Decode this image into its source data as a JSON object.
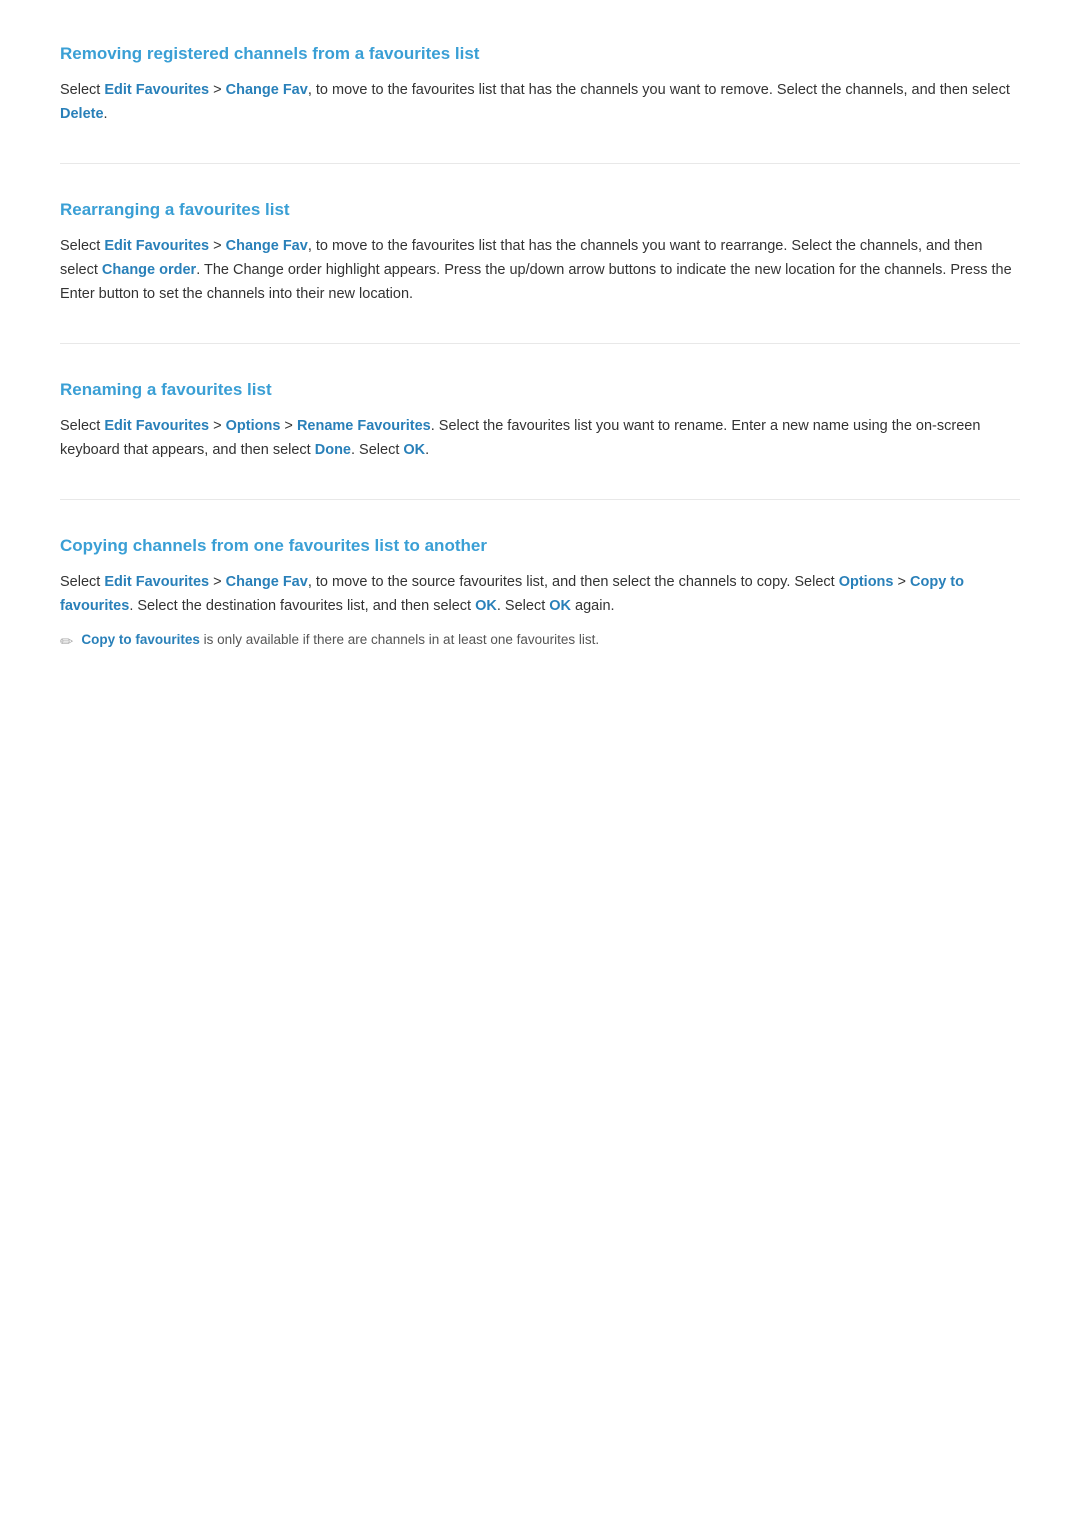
{
  "sections": [
    {
      "id": "removing",
      "title": "Removing registered channels from a favourites list",
      "body_parts": [
        {
          "type": "text",
          "text": "Select "
        },
        {
          "type": "highlight",
          "text": "Edit Favourites"
        },
        {
          "type": "text",
          "text": " > "
        },
        {
          "type": "highlight",
          "text": "Change Fav"
        },
        {
          "type": "text",
          "text": ", to move to the favourites list that has the channels you want to remove. Select the channels, and then select "
        },
        {
          "type": "highlight",
          "text": "Delete"
        },
        {
          "type": "text",
          "text": "."
        }
      ]
    },
    {
      "id": "rearranging",
      "title": "Rearranging a favourites list",
      "body_parts": [
        {
          "type": "text",
          "text": "Select "
        },
        {
          "type": "highlight",
          "text": "Edit Favourites"
        },
        {
          "type": "text",
          "text": " > "
        },
        {
          "type": "highlight",
          "text": "Change Fav"
        },
        {
          "type": "text",
          "text": ", to move to the favourites list that has the channels you want to rearrange. Select the channels, and then select "
        },
        {
          "type": "highlight",
          "text": "Change order"
        },
        {
          "type": "text",
          "text": ". The Change order highlight appears. Press the up/down arrow buttons to indicate the new location for the channels. Press the Enter button to set the channels into their new location."
        }
      ]
    },
    {
      "id": "renaming",
      "title": "Renaming a favourites list",
      "body_parts": [
        {
          "type": "text",
          "text": "Select "
        },
        {
          "type": "highlight",
          "text": "Edit Favourites"
        },
        {
          "type": "text",
          "text": " > "
        },
        {
          "type": "highlight",
          "text": "Options"
        },
        {
          "type": "text",
          "text": " > "
        },
        {
          "type": "highlight",
          "text": "Rename Favourites"
        },
        {
          "type": "text",
          "text": ". Select the favourites list you want to rename. Enter a new name using the on-screen keyboard that appears, and then select "
        },
        {
          "type": "highlight",
          "text": "Done"
        },
        {
          "type": "text",
          "text": ". Select "
        },
        {
          "type": "highlight",
          "text": "OK"
        },
        {
          "type": "text",
          "text": "."
        }
      ]
    },
    {
      "id": "copying",
      "title": "Copying channels from one favourites list to another",
      "body_parts": [
        {
          "type": "text",
          "text": "Select "
        },
        {
          "type": "highlight",
          "text": "Edit Favourites"
        },
        {
          "type": "text",
          "text": " > "
        },
        {
          "type": "highlight",
          "text": "Change Fav"
        },
        {
          "type": "text",
          "text": ", to move to the source favourites list, and then select the channels to copy. Select "
        },
        {
          "type": "highlight",
          "text": "Options"
        },
        {
          "type": "text",
          "text": " > "
        },
        {
          "type": "highlight",
          "text": "Copy to favourites"
        },
        {
          "type": "text",
          "text": ". Select the destination favourites list, and then select "
        },
        {
          "type": "highlight",
          "text": "OK"
        },
        {
          "type": "text",
          "text": ". Select "
        },
        {
          "type": "highlight",
          "text": "OK"
        },
        {
          "type": "text",
          "text": " again."
        }
      ],
      "note": {
        "highlight": "Copy to favourites",
        "text": " is only available if there are channels in at least one favourites list."
      }
    }
  ]
}
